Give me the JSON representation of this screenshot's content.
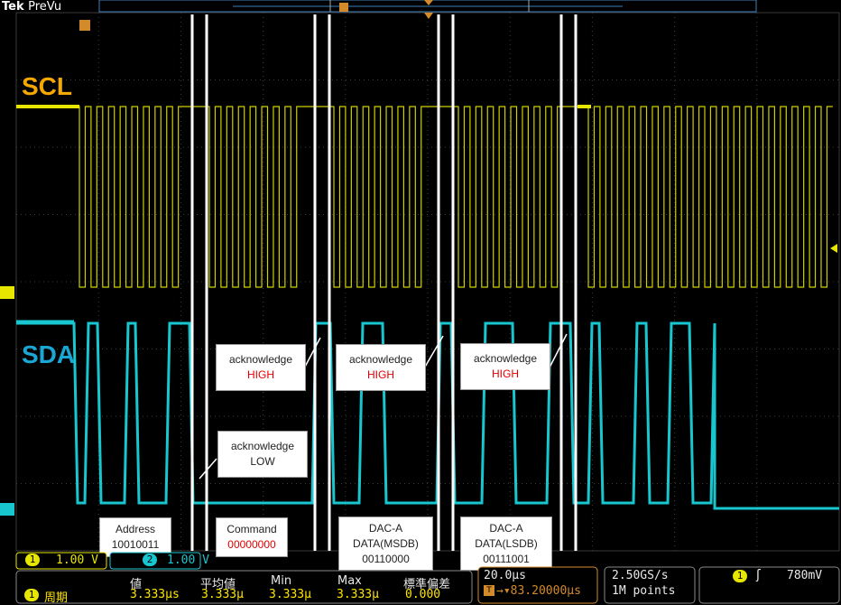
{
  "brand": {
    "name": "Tek",
    "mode": "PreVu"
  },
  "traces": {
    "scl": {
      "label": "SCL",
      "color": "#f5a800",
      "waveform_color": "#e6e600"
    },
    "sda": {
      "label": "SDA",
      "color": "#1aa7d6",
      "waveform_color": "#18c6cf"
    }
  },
  "channel_markers": {
    "ch1": "1",
    "ch2": "2",
    "trigger": "T"
  },
  "callouts": {
    "ack_high_1": {
      "line1": "acknowledge",
      "line2": "HIGH"
    },
    "ack_high_2": {
      "line1": "acknowledge",
      "line2": "HIGH"
    },
    "ack_high_3": {
      "line1": "acknowledge",
      "line2": "HIGH"
    },
    "ack_low": {
      "line1": "acknowledge",
      "line2": "LOW"
    },
    "address": {
      "line1": "Address",
      "line2": "10010011"
    },
    "command": {
      "line1": "Command",
      "line2": "00000000"
    },
    "dac_msdb": {
      "line1": "DAC-A",
      "line2": "DATA(MSDB)",
      "line3": "00110000"
    },
    "dac_lsdb": {
      "line1": "DAC-A",
      "line2": "DATA(LSDB)",
      "line3": "00111001"
    }
  },
  "status": {
    "ch1_scale": "1.00 V",
    "ch2_scale": "1.00 V",
    "timebase": "20.0µs",
    "trigger_pos": "83.20000µs",
    "sample_rate": "2.50GS/s",
    "record_length": "1M points",
    "trigger_level": "780mV",
    "trigger_channel": "1"
  },
  "measurement": {
    "headers": [
      "値",
      "平均値",
      "Min",
      "Max",
      "標準偏差"
    ],
    "label": "周期",
    "channel": "1",
    "values": [
      "3.333µs",
      "3.333µ",
      "3.333µ",
      "3.333µ",
      "0.000"
    ]
  }
}
